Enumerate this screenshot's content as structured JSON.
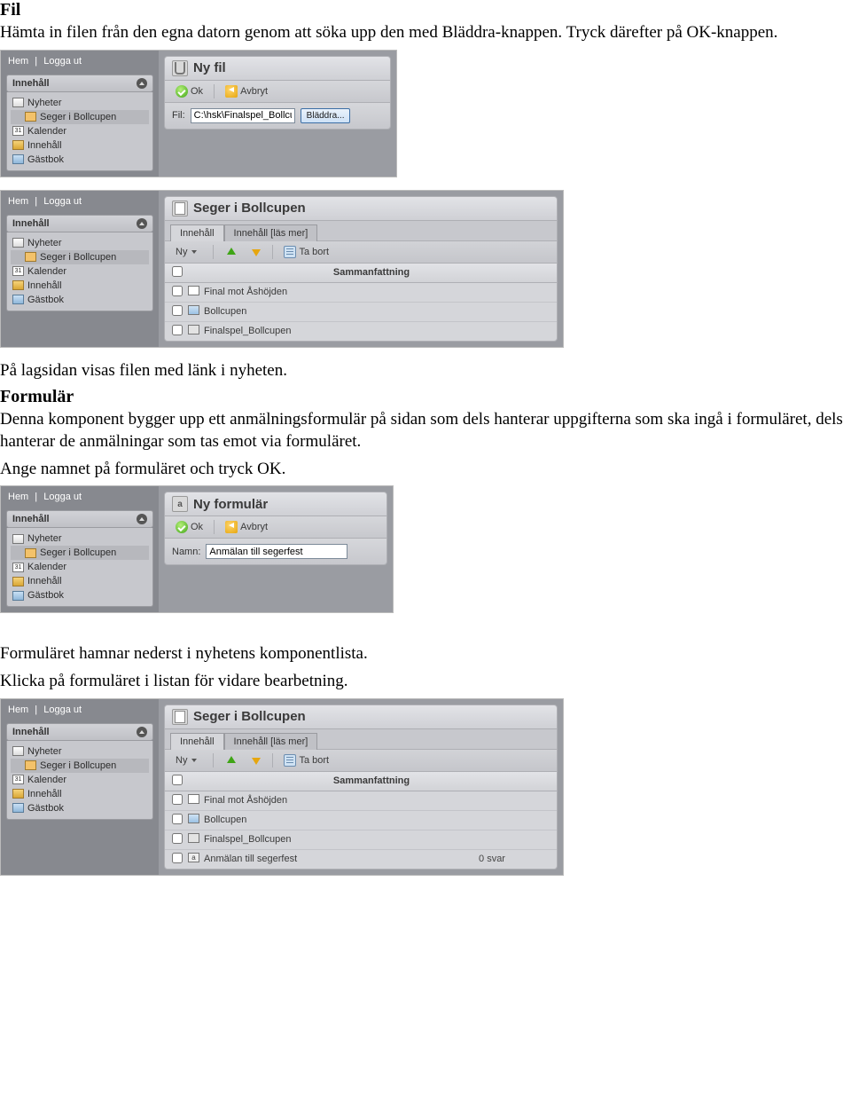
{
  "doc": {
    "h1_fil": "Fil",
    "p_fil": "Hämta in filen från den egna datorn genom att söka upp den med Bläddra-knappen. Tryck därefter på OK-knappen.",
    "p_lagsidan": "På lagsidan visas filen med länk i nyheten.",
    "h1_form": "Formulär",
    "p_form1": "Denna komponent bygger upp ett anmälningsformulär på sidan som dels hanterar uppgifterna som ska ingå i formuläret, dels hanterar de anmälningar som tas emot via formuläret.",
    "p_form2": "Ange namnet på formuläret och tryck OK.",
    "p_form3": "Formuläret hamnar nederst i nyhetens komponentlista.",
    "p_form4": "Klicka på formuläret i listan för vidare bearbetning."
  },
  "common": {
    "topnav": {
      "home": "Hem",
      "logout": "Logga ut",
      "sep": "|"
    },
    "section_label": "Innehåll",
    "nav": [
      {
        "label": "Nyheter",
        "icon": "news",
        "indent": 0,
        "sel": false
      },
      {
        "label": "Seger i Bollcupen",
        "icon": "box",
        "indent": 1,
        "sel": true
      },
      {
        "label": "Kalender",
        "icon": "cal",
        "num": "31",
        "indent": 0,
        "sel": false
      },
      {
        "label": "Innehåll",
        "icon": "folder",
        "indent": 0,
        "sel": false
      },
      {
        "label": "Gästbok",
        "icon": "book",
        "indent": 0,
        "sel": false
      }
    ],
    "buttons": {
      "ok": "Ok",
      "cancel": "Avbryt",
      "new": "Ny",
      "remove": "Ta bort"
    },
    "tabs": {
      "t1": "Innehåll",
      "t2": "Innehåll [läs mer]"
    },
    "table": {
      "summary": "Sammanfattning"
    }
  },
  "shot1": {
    "title": "Ny fil",
    "file_label": "Fil:",
    "file_value": "C:\\hsk\\Finalspel_Bollcu",
    "browse": "Bläddra..."
  },
  "shot2": {
    "title": "Seger i Bollcupen",
    "rows": [
      {
        "icon": "txt",
        "name": "Final mot Åshöjden",
        "rest": ""
      },
      {
        "icon": "img",
        "name": "Bollcupen",
        "rest": ""
      },
      {
        "icon": "doc",
        "name": "Finalspel_Bollcupen",
        "rest": ""
      }
    ]
  },
  "shot3": {
    "title": "Ny formulär",
    "name_label": "Namn:",
    "name_value": "Anmälan till segerfest"
  },
  "shot4": {
    "title": "Seger i Bollcupen",
    "rows": [
      {
        "icon": "txt",
        "name": "Final mot Åshöjden",
        "rest": ""
      },
      {
        "icon": "img",
        "name": "Bollcupen",
        "rest": ""
      },
      {
        "icon": "doc",
        "name": "Finalspel_Bollcupen",
        "rest": ""
      },
      {
        "icon": "frm",
        "name": "Anmälan till segerfest",
        "rest": "0 svar"
      }
    ]
  }
}
